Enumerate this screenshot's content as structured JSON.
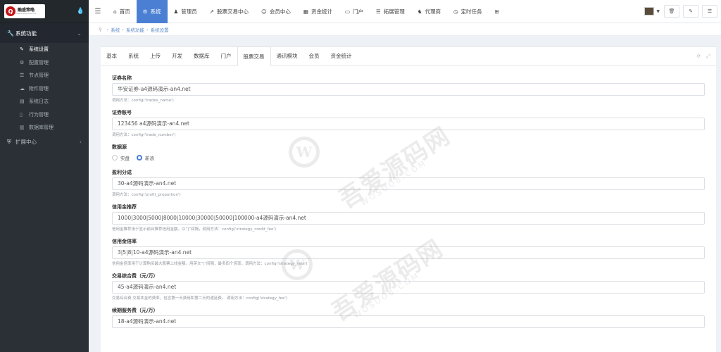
{
  "logo": {
    "mark": "Q",
    "name": "融盛策略",
    "sub": "RONGSHENGCELUE.VIP"
  },
  "sidebar": {
    "groups": [
      {
        "label": "系统功能",
        "icon": "wrench-icon"
      },
      {
        "label": "扩展中心",
        "icon": "shield-icon"
      }
    ],
    "items": [
      {
        "label": "系统设置"
      },
      {
        "label": "配置管理"
      },
      {
        "label": "节点管理"
      },
      {
        "label": "附件管理"
      },
      {
        "label": "系统日志"
      },
      {
        "label": "行为管理"
      },
      {
        "label": "数据库管理"
      }
    ]
  },
  "topnav": {
    "items": [
      {
        "label": "首页",
        "glyph": "⌂"
      },
      {
        "label": "系统",
        "glyph": "⚙"
      },
      {
        "label": "管理员",
        "glyph": "♟"
      },
      {
        "label": "股票交易中心",
        "glyph": "↗"
      },
      {
        "label": "会员中心",
        "glyph": "☺"
      },
      {
        "label": "资金统计",
        "glyph": "▦"
      },
      {
        "label": "门户",
        "glyph": "▭"
      },
      {
        "label": "拓展管理",
        "glyph": "☰"
      },
      {
        "label": "代理商",
        "glyph": "♞"
      },
      {
        "label": "定时任务",
        "glyph": "◷"
      }
    ]
  },
  "breadcrumb": {
    "items": [
      "系统",
      "系统功能",
      "系统设置"
    ]
  },
  "tabs": [
    "基本",
    "系统",
    "上传",
    "开发",
    "数据库",
    "门户",
    "股票交易",
    "通讯模块",
    "会员",
    "资金统计"
  ],
  "active_tab": "股票交易",
  "form": {
    "trade_name": {
      "label": "证券名称",
      "value": "华安证券-a4源码演示-an4.net",
      "help": "调用方法：config('tradex_name')"
    },
    "trade_number": {
      "label": "证券账号",
      "value": "123456  a4源码演示-an4.net",
      "help": "调用方法：config('trade_number')"
    },
    "data_source": {
      "label": "数据源",
      "options": [
        "实盘",
        "新浪"
      ],
      "selected": "新浪"
    },
    "profit_proportion": {
      "label": "盈利分成",
      "value": "30-a4源码演示-an4.net",
      "help": "调用方法：config('profit_proportion')"
    },
    "strategy_credit_fee": {
      "label": "信用金推荐",
      "value": "1000|3000|5000|8000|10000|30000|50000|100000-a4源码演示-an4.net",
      "help": "信用金推荐用于显示前台推荐信用金额。以“|”间隔，调用方法：config('strategy_credit_fee')"
    },
    "strategy_rate": {
      "label": "信用金倍率",
      "value": "3|5|8|10-a4源码演示-an4.net",
      "help": "信用金倍率用于计算购买最大股票上线金额。用英文“|”间隔，最多四个倍率。调用方法：config('strategy_rate')"
    },
    "strategy_fee": {
      "label": "交易综合费（元/万）",
      "value": "45-a4源码演示-an4.net",
      "help": "交易综合费 交易本金的费率，包含第一天费用和第二天的递延费。 调用方法：config('strategy_fee')"
    },
    "renewal_fee": {
      "label": "续期服务费（元/万）",
      "value": "18-a4源码演示-an4.net"
    }
  },
  "watermark": {
    "mark": "W",
    "text": "吾爱源码网",
    "url": "WOSUO8.COM"
  },
  "colors": {
    "accent": "#4a7fd4",
    "sidebar_bg": "#2a3036",
    "link": "#5b8ac9"
  }
}
